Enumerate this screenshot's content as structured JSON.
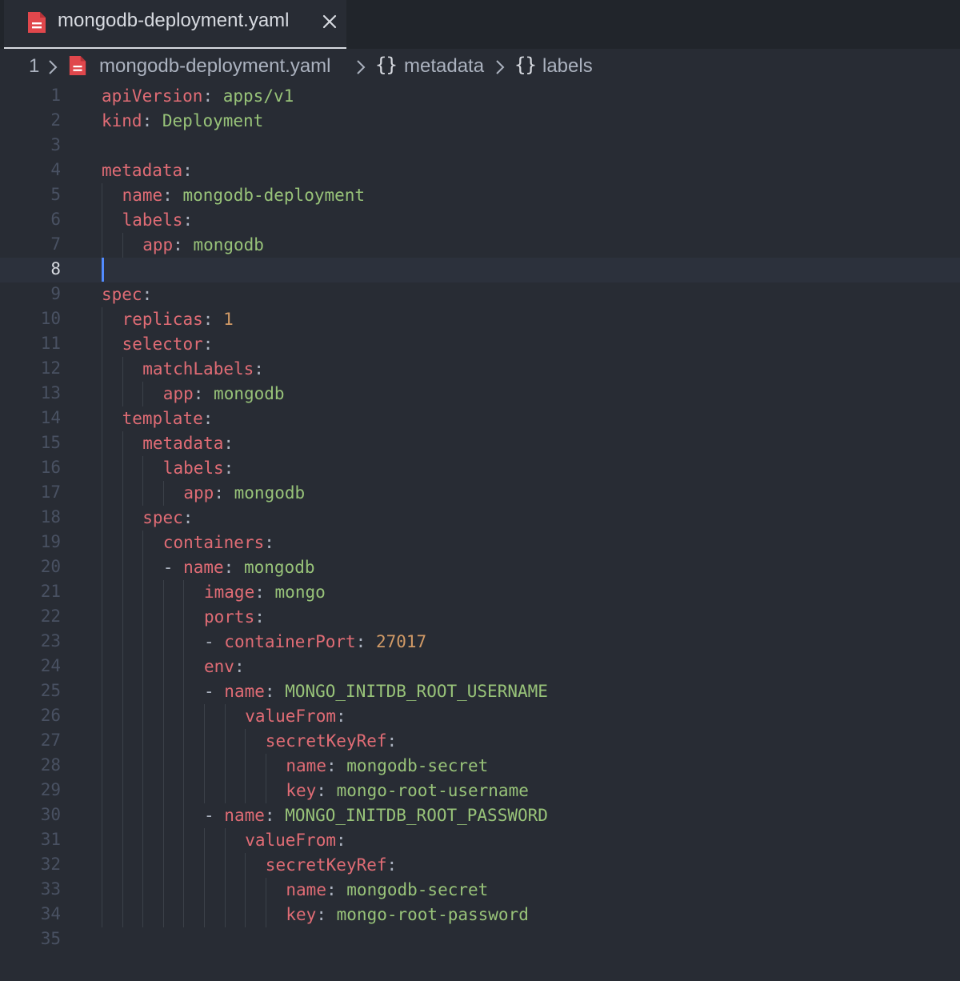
{
  "tab": {
    "filename": "mongodb-deployment.yaml",
    "file_icon": "yaml-file-icon",
    "close_icon": "close-icon"
  },
  "breadcrumb": {
    "line_prefix": "1",
    "file": "mongodb-deployment.yaml",
    "items": [
      "metadata",
      "labels"
    ],
    "braces": "{}"
  },
  "editor": {
    "current_line": 8,
    "colors": {
      "key": "#e06c75",
      "string": "#98c379",
      "number": "#d19a66",
      "punct": "#abb2bf",
      "cursor": "#528bff",
      "background": "#282c34"
    },
    "lines": [
      {
        "num": "1",
        "indent": 0,
        "dash": false,
        "key": "apiVersion",
        "value": "apps/v1",
        "vtype": "s"
      },
      {
        "num": "2",
        "indent": 0,
        "dash": false,
        "key": "kind",
        "value": "Deployment",
        "vtype": "s"
      },
      {
        "num": "3",
        "indent": 0,
        "dash": false,
        "key": "",
        "value": "",
        "vtype": ""
      },
      {
        "num": "4",
        "indent": 0,
        "dash": false,
        "key": "metadata",
        "value": "",
        "vtype": ""
      },
      {
        "num": "5",
        "indent": 1,
        "dash": false,
        "key": "name",
        "value": "mongodb-deployment",
        "vtype": "s"
      },
      {
        "num": "6",
        "indent": 1,
        "dash": false,
        "key": "labels",
        "value": "",
        "vtype": ""
      },
      {
        "num": "7",
        "indent": 2,
        "dash": false,
        "key": "app",
        "value": "mongodb",
        "vtype": "s"
      },
      {
        "num": "8",
        "indent": 0,
        "dash": false,
        "key": "",
        "value": "",
        "vtype": ""
      },
      {
        "num": "9",
        "indent": 0,
        "dash": false,
        "key": "spec",
        "value": "",
        "vtype": ""
      },
      {
        "num": "10",
        "indent": 1,
        "dash": false,
        "key": "replicas",
        "value": "1",
        "vtype": "n"
      },
      {
        "num": "11",
        "indent": 1,
        "dash": false,
        "key": "selector",
        "value": "",
        "vtype": ""
      },
      {
        "num": "12",
        "indent": 2,
        "dash": false,
        "key": "matchLabels",
        "value": "",
        "vtype": ""
      },
      {
        "num": "13",
        "indent": 3,
        "dash": false,
        "key": "app",
        "value": "mongodb",
        "vtype": "s"
      },
      {
        "num": "14",
        "indent": 1,
        "dash": false,
        "key": "template",
        "value": "",
        "vtype": ""
      },
      {
        "num": "15",
        "indent": 2,
        "dash": false,
        "key": "metadata",
        "value": "",
        "vtype": ""
      },
      {
        "num": "16",
        "indent": 3,
        "dash": false,
        "key": "labels",
        "value": "",
        "vtype": ""
      },
      {
        "num": "17",
        "indent": 4,
        "dash": false,
        "key": "app",
        "value": "mongodb",
        "vtype": "s"
      },
      {
        "num": "18",
        "indent": 2,
        "dash": false,
        "key": "spec",
        "value": "",
        "vtype": ""
      },
      {
        "num": "19",
        "indent": 3,
        "dash": false,
        "key": "containers",
        "value": "",
        "vtype": ""
      },
      {
        "num": "20",
        "indent": 4,
        "dash": true,
        "key": "name",
        "value": "mongodb",
        "vtype": "s"
      },
      {
        "num": "21",
        "indent": 5,
        "dash": false,
        "key": "image",
        "value": "mongo",
        "vtype": "s"
      },
      {
        "num": "22",
        "indent": 5,
        "dash": false,
        "key": "ports",
        "value": "",
        "vtype": ""
      },
      {
        "num": "23",
        "indent": 6,
        "dash": true,
        "key": "containerPort",
        "value": "27017",
        "vtype": "n"
      },
      {
        "num": "24",
        "indent": 5,
        "dash": false,
        "key": "env",
        "value": "",
        "vtype": ""
      },
      {
        "num": "25",
        "indent": 6,
        "dash": true,
        "key": "name",
        "value": "MONGO_INITDB_ROOT_USERNAME",
        "vtype": "s"
      },
      {
        "num": "26",
        "indent": 7,
        "dash": false,
        "key": "valueFrom",
        "value": "",
        "vtype": ""
      },
      {
        "num": "27",
        "indent": 8,
        "dash": false,
        "key": "secretKeyRef",
        "value": "",
        "vtype": ""
      },
      {
        "num": "28",
        "indent": 9,
        "dash": false,
        "key": "name",
        "value": "mongodb-secret",
        "vtype": "s"
      },
      {
        "num": "29",
        "indent": 9,
        "dash": false,
        "key": "key",
        "value": "mongo-root-username",
        "vtype": "s"
      },
      {
        "num": "30",
        "indent": 6,
        "dash": true,
        "key": "name",
        "value": "MONGO_INITDB_ROOT_PASSWORD",
        "vtype": "s"
      },
      {
        "num": "31",
        "indent": 7,
        "dash": false,
        "key": "valueFrom",
        "value": "",
        "vtype": ""
      },
      {
        "num": "32",
        "indent": 8,
        "dash": false,
        "key": "secretKeyRef",
        "value": "",
        "vtype": ""
      },
      {
        "num": "33",
        "indent": 9,
        "dash": false,
        "key": "name",
        "value": "mongodb-secret",
        "vtype": "s"
      },
      {
        "num": "34",
        "indent": 9,
        "dash": false,
        "key": "key",
        "value": "mongo-root-password",
        "vtype": "s"
      },
      {
        "num": "35",
        "indent": 0,
        "dash": false,
        "key": "",
        "value": "",
        "vtype": ""
      }
    ]
  }
}
